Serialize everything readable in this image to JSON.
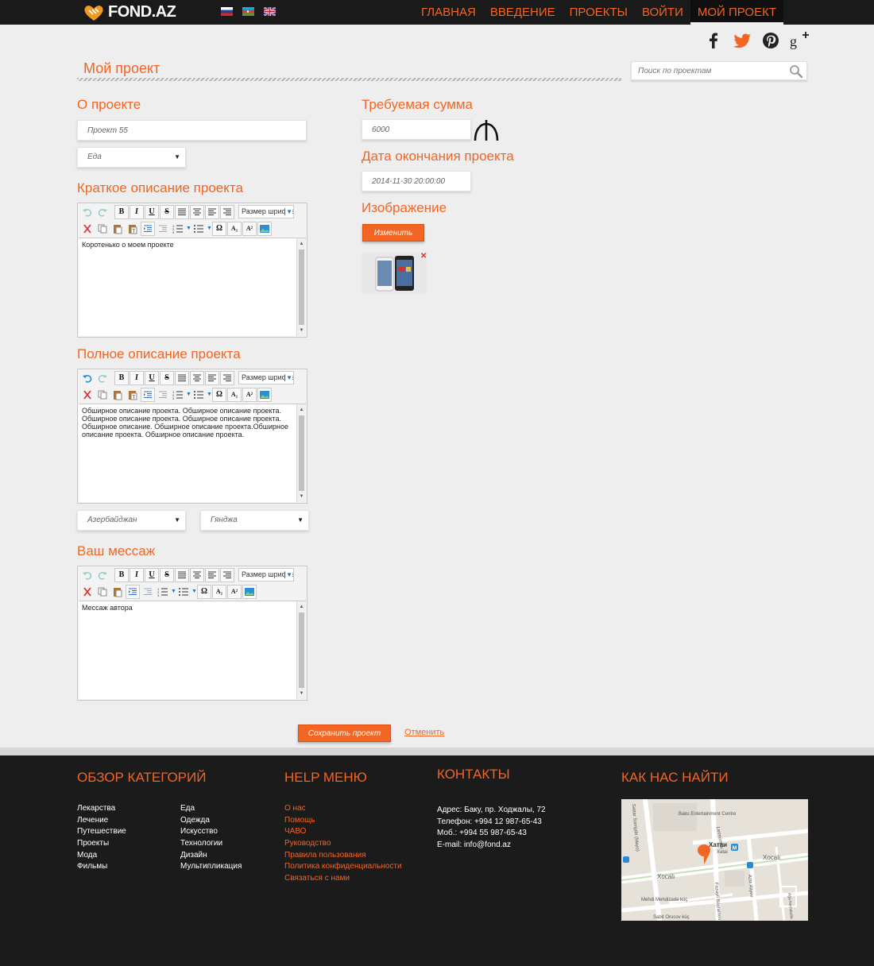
{
  "header": {
    "logo_text": "FOND.AZ",
    "languages": [
      "ru",
      "az",
      "en"
    ],
    "nav": [
      "ГЛАВНАЯ",
      "ВВЕДЕНИЕ",
      "ПРОЕКТЫ",
      "ВОЙТИ",
      "МОЙ ПРОЕКТ"
    ],
    "active_nav": "МОЙ ПРОЕКТ"
  },
  "social": [
    "facebook-icon",
    "twitter-icon",
    "pinterest-icon",
    "google-plus-icon"
  ],
  "page_title": "Мой проект",
  "search": {
    "placeholder": "Поиск по проектам"
  },
  "form": {
    "about_heading": "О проекте",
    "project_name": "Проект 55",
    "category": "Еда",
    "short_heading": "Краткое описание проекта",
    "short_text": "Коротенько о моем проекте",
    "full_heading": "Полное описание проекта",
    "full_text": "Обширное описание проекта. Обширное описание проекта. Обширное описание проекта. Обширное описание проекта. Обширное описание. Обширное описание проекта.Обширное описание проекта. Обширное описание проекта.",
    "country": "Азербайджан",
    "city": "Гянджа",
    "message_heading": "Ваш мессаж",
    "message_text": "Мессаж автора",
    "font_size_label": "Размер шрифта",
    "amount_heading": "Требуемая сумма",
    "amount_value": "6000",
    "deadline_heading": "Дата окончания проекта",
    "deadline_value": "2014-11-30 20:00:00",
    "image_heading": "Изображение",
    "change_button": "Изменить",
    "save_button": "Сохранить проект",
    "cancel_link": "Отменить"
  },
  "footer": {
    "categories_heading": "ОБЗОР КАТЕГОРИЙ",
    "categories_col1": [
      "Лекарства",
      "Лечение",
      "Путешествие",
      "Проекты",
      "Мода",
      "Фильмы"
    ],
    "categories_col2": [
      "Еда",
      "Одежда",
      "Искусство",
      "Технологии",
      "Дизайн",
      "Мультипликация"
    ],
    "help_heading": "HELP МЕНЮ",
    "help_items": [
      "О нас",
      "Помощь",
      "ЧАВО",
      "Руководство",
      "Правила пользования",
      "Политика конфиденциальности",
      "Связаться с нами"
    ],
    "contacts_heading": "КОНТАКТЫ",
    "address": "Адрес: Баку, пр. Ходжалы, 72",
    "phone": "Телефон: +994 12 987-65-43",
    "mobile": "Моб.: +994 55 987-65-43",
    "email": "E-mail: info@fond.az",
    "find_heading": "КАК НАС НАЙТИ",
    "map_labels": {
      "baku_centre": "Baku Entertainment Centre",
      "xatai_ru": "Хатаи",
      "xatai_az": "Xətai",
      "xocali_1": "Xocalı",
      "xocali_2": "Xocalı",
      "lermontov": "Lermontov",
      "serxedgi": "Səttar Sərnjabi (Mayo)",
      "mehdi": "Mehdi Mehdizadə küç",
      "fazayil": "Fazayil Bayramov",
      "aziz": "Aziz Aliyev",
      "sabit": "Sabit Orucov küç",
      "aga": "Ağa Nematulla"
    }
  },
  "colors": {
    "accent": "#f26522",
    "header_bg": "#1a1a1a",
    "footer_bg": "#1b1b1b",
    "page_bg": "#eeeeee"
  }
}
